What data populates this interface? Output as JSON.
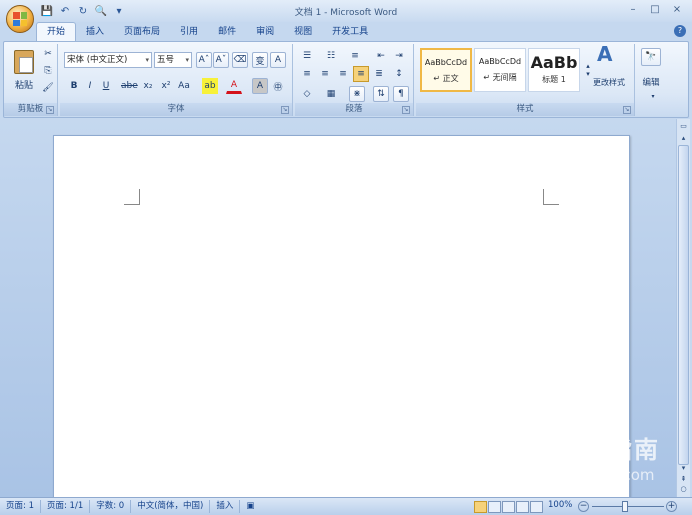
{
  "window": {
    "title": "文档 1 - Microsoft Word",
    "minimize": "–",
    "maximize": "□",
    "close": "×"
  },
  "qat": {
    "save": "💾",
    "undo": "↶",
    "redo": "↻",
    "print_preview": "🔍",
    "more": "▾"
  },
  "tabs": [
    "开始",
    "插入",
    "页面布局",
    "引用",
    "邮件",
    "审阅",
    "视图",
    "开发工具"
  ],
  "ribbon": {
    "clipboard": {
      "label": "剪贴板",
      "paste": "粘贴",
      "cut": "✂",
      "copy": "⎘",
      "format_painter": "🖌"
    },
    "font": {
      "label": "字体",
      "font_name": "宋体 (中文正文)",
      "font_size": "五号",
      "grow": "Aˆ",
      "shrink": "Aˇ",
      "clear": "⌫",
      "phonetic": "变",
      "border": "A",
      "bold": "B",
      "italic": "I",
      "underline": "U",
      "strike": "abe",
      "subscript": "x₂",
      "superscript": "x²",
      "case": "Aa",
      "highlight": "ab",
      "font_color": "A",
      "shade": "A",
      "enclose": "㊥"
    },
    "paragraph": {
      "label": "段落",
      "bullets": "☰",
      "numbering": "☷",
      "multilevel": "≡",
      "decrease_indent": "⇤",
      "increase_indent": "⇥",
      "align_left": "≡",
      "center": "≡",
      "align_right": "≡",
      "justify": "≡",
      "distributed": "≣",
      "line_spacing": "↕",
      "shading": "◇",
      "borders": "▦",
      "chinese_layout": "⋇",
      "sort": "⇅",
      "show_marks": "¶"
    },
    "styles": {
      "label": "样式",
      "items": [
        {
          "sample": "AaBbCcDd",
          "name": "↵ 正文"
        },
        {
          "sample": "AaBbCcDd",
          "name": "↵ 无间隔"
        },
        {
          "sample": "AaBb",
          "name": "标题 1"
        }
      ],
      "change_styles": "更改样式"
    },
    "editing": {
      "label": "编辑"
    }
  },
  "statusbar": {
    "page": "页面: 1",
    "pages": "页面: 1/1",
    "words": "字数: 0",
    "language": "中文(简体，中国)",
    "insert": "插入",
    "zoom": "100%",
    "zoom_minus": "−",
    "zoom_plus": "+"
  },
  "watermark": {
    "text": "搜狗指南",
    "url": "zhinan.sogou.com"
  },
  "colors": {
    "ribbon_bg": "#dbe7f6",
    "title_bg": "#c8daf0",
    "doc_bg": "#a9c3e5",
    "accent": "#15428b",
    "style_selected": "#f0b845"
  }
}
